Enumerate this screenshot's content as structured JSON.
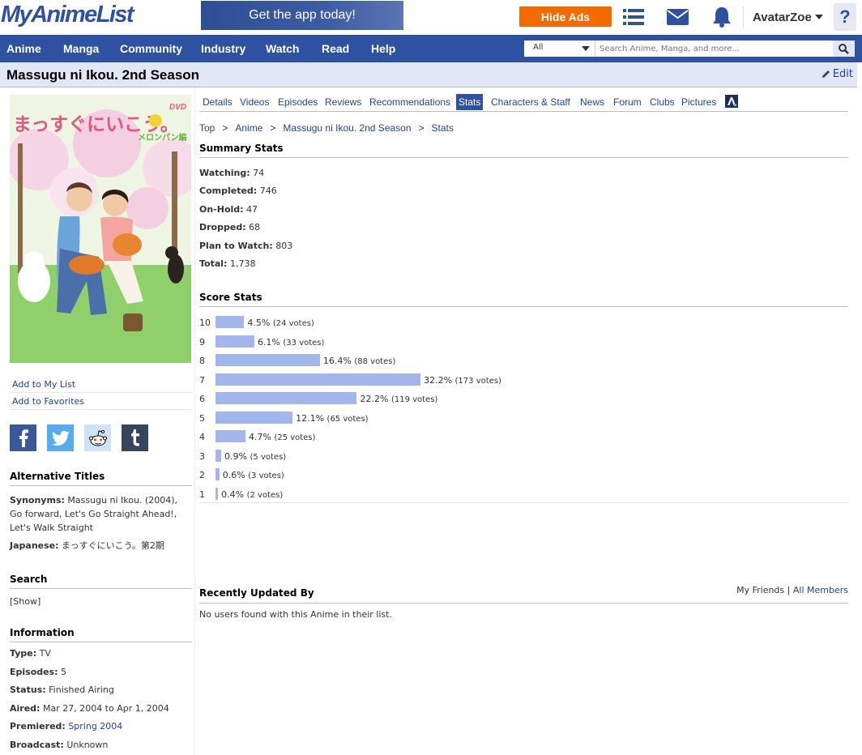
{
  "header": {
    "logo": "MyAnimeList",
    "app_banner": "Get the app today!",
    "hide_ads": "Hide Ads",
    "username": "AvatarZoe",
    "help": "?"
  },
  "nav": {
    "items": [
      "Anime",
      "Manga",
      "Community",
      "Industry",
      "Watch",
      "Read",
      "Help"
    ],
    "search_select": "All",
    "search_placeholder": "Search Anime, Manga, and more..."
  },
  "title_bar": {
    "title": "Massugu ni Ikou. 2nd Season",
    "edit": "Edit"
  },
  "tabs": [
    "Details",
    "Videos",
    "Episodes",
    "Reviews",
    "Recommendations",
    "Stats",
    "Characters & Staff",
    "News",
    "Forum",
    "Clubs",
    "Pictures"
  ],
  "active_tab": "Stats",
  "breadcrumb": [
    "Top",
    "Anime",
    "Massugu ni Ikou. 2nd Season",
    "Stats"
  ],
  "sidebar": {
    "add_to_list": "Add to My List",
    "add_to_favorites": "Add to Favorites",
    "share": [
      "facebook",
      "twitter",
      "reddit",
      "tumblr"
    ],
    "alt_titles_heading": "Alternative Titles",
    "synonyms_label": "Synonyms:",
    "synonyms_value": "Massugu ni Ikou. (2004), Go forward, Let's Go Straight Ahead!, Let's Walk Straight",
    "japanese_label": "Japanese:",
    "japanese_value": "まっすぐにいこう。第2期",
    "search_heading": "Search",
    "search_show": "[Show]",
    "info_heading": "Information",
    "info": {
      "type_label": "Type:",
      "type_value": "TV",
      "episodes_label": "Episodes:",
      "episodes_value": "5",
      "status_label": "Status:",
      "status_value": "Finished Airing",
      "aired_label": "Aired:",
      "aired_value": "Mar 27, 2004 to Apr 1, 2004",
      "premiered_label": "Premiered:",
      "premiered_value": "Spring 2004",
      "broadcast_label": "Broadcast:",
      "broadcast_value": "Unknown"
    },
    "cover_title": "まっすぐにいこう。",
    "cover_badge": "DVD",
    "cover_subtitle": "メロンパン編"
  },
  "summary": {
    "heading": "Summary Stats",
    "watching_label": "Watching:",
    "watching": "74",
    "completed_label": "Completed:",
    "completed": "746",
    "onhold_label": "On-Hold:",
    "onhold": "47",
    "dropped_label": "Dropped:",
    "dropped": "68",
    "plan_label": "Plan to Watch:",
    "plan": "803",
    "total_label": "Total:",
    "total": "1,738"
  },
  "scores": {
    "heading": "Score Stats",
    "rows": [
      {
        "score": "10",
        "pct": 4.5,
        "pct_text": "4.5%",
        "votes": "(24 votes)"
      },
      {
        "score": "9",
        "pct": 6.1,
        "pct_text": "6.1%",
        "votes": "(33 votes)"
      },
      {
        "score": "8",
        "pct": 16.4,
        "pct_text": "16.4%",
        "votes": "(88 votes)"
      },
      {
        "score": "7",
        "pct": 32.2,
        "pct_text": "32.2%",
        "votes": "(173 votes)"
      },
      {
        "score": "6",
        "pct": 22.2,
        "pct_text": "22.2%",
        "votes": "(119 votes)"
      },
      {
        "score": "5",
        "pct": 12.1,
        "pct_text": "12.1%",
        "votes": "(65 votes)"
      },
      {
        "score": "4",
        "pct": 4.7,
        "pct_text": "4.7%",
        "votes": "(25 votes)"
      },
      {
        "score": "3",
        "pct": 0.9,
        "pct_text": "0.9%",
        "votes": "(5 votes)"
      },
      {
        "score": "2",
        "pct": 0.6,
        "pct_text": "0.6%",
        "votes": "(3 votes)"
      },
      {
        "score": "1",
        "pct": 0.4,
        "pct_text": "0.4%",
        "votes": "(2 votes)"
      }
    ]
  },
  "recent": {
    "heading": "Recently Updated By",
    "my_friends": "My Friends",
    "separator": "|",
    "all_members": "All Members",
    "empty": "No users found with this Anime in their list."
  },
  "colors": {
    "brand": "#2e51a2",
    "orange": "#f26b00",
    "bar": "#a3b6eb",
    "link": "#1c439b"
  }
}
